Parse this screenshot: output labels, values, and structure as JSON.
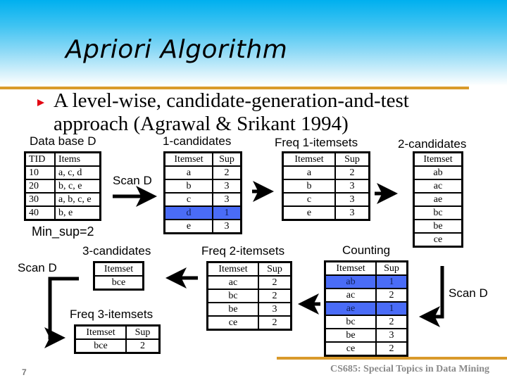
{
  "slide": {
    "title": "Apriori Algorithm",
    "bullet": "A level-wise, candidate-generation-and-test approach (Agrawal & Srikant 1994)",
    "footer": "CS685: Special Topics in Data Mining",
    "page_number": "7",
    "colors": {
      "header_gradient_top": "#00b0ef",
      "rule": "#d99a2b",
      "bullet": "#e30613",
      "pruned_highlight": "#4a6cf7",
      "footer_text": "#8a8a8a"
    }
  },
  "labels": {
    "database": "Data base D",
    "min_sup": "Min_sup=2",
    "scan_1": "Scan D",
    "scan_2": "Scan D",
    "scan_3": "Scan D",
    "c1": "1-candidates",
    "l1": "Freq 1-itemsets",
    "c2": "2-candidates",
    "counting": "Counting",
    "l2": "Freq 2-itemsets",
    "c3": "3-candidates",
    "l3": "Freq 3-itemsets"
  },
  "database": {
    "headers": [
      "TID",
      "Items"
    ],
    "rows": [
      {
        "tid": "10",
        "items": "a, c, d"
      },
      {
        "tid": "20",
        "items": "b, c, e"
      },
      {
        "tid": "30",
        "items": "a, b, c, e"
      },
      {
        "tid": "40",
        "items": "b, e"
      }
    ]
  },
  "candidates_1": {
    "headers": [
      "Itemset",
      "Sup"
    ],
    "rows": [
      {
        "itemset": "a",
        "sup": "2",
        "pruned": false
      },
      {
        "itemset": "b",
        "sup": "3",
        "pruned": false
      },
      {
        "itemset": "c",
        "sup": "3",
        "pruned": false
      },
      {
        "itemset": "d",
        "sup": "1",
        "pruned": true
      },
      {
        "itemset": "e",
        "sup": "3",
        "pruned": false
      }
    ]
  },
  "frequent_1": {
    "headers": [
      "Itemset",
      "Sup"
    ],
    "rows": [
      {
        "itemset": "a",
        "sup": "2"
      },
      {
        "itemset": "b",
        "sup": "3"
      },
      {
        "itemset": "c",
        "sup": "3"
      },
      {
        "itemset": "e",
        "sup": "3"
      }
    ]
  },
  "candidates_2": {
    "headers": [
      "Itemset"
    ],
    "rows": [
      {
        "itemset": "ab"
      },
      {
        "itemset": "ac"
      },
      {
        "itemset": "ae"
      },
      {
        "itemset": "bc"
      },
      {
        "itemset": "be"
      },
      {
        "itemset": "ce"
      }
    ]
  },
  "counting": {
    "headers": [
      "Itemset",
      "Sup"
    ],
    "rows": [
      {
        "itemset": "ab",
        "sup": "1",
        "pruned": true
      },
      {
        "itemset": "ac",
        "sup": "2",
        "pruned": false
      },
      {
        "itemset": "ae",
        "sup": "1",
        "pruned": true
      },
      {
        "itemset": "bc",
        "sup": "2",
        "pruned": false
      },
      {
        "itemset": "be",
        "sup": "3",
        "pruned": false
      },
      {
        "itemset": "ce",
        "sup": "2",
        "pruned": false
      }
    ]
  },
  "frequent_2": {
    "headers": [
      "Itemset",
      "Sup"
    ],
    "rows": [
      {
        "itemset": "ac",
        "sup": "2"
      },
      {
        "itemset": "bc",
        "sup": "2"
      },
      {
        "itemset": "be",
        "sup": "3"
      },
      {
        "itemset": "ce",
        "sup": "2"
      }
    ]
  },
  "candidates_3": {
    "headers": [
      "Itemset"
    ],
    "rows": [
      {
        "itemset": "bce"
      }
    ]
  },
  "frequent_3": {
    "headers": [
      "Itemset",
      "Sup"
    ],
    "rows": [
      {
        "itemset": "bce",
        "sup": "2"
      }
    ]
  }
}
